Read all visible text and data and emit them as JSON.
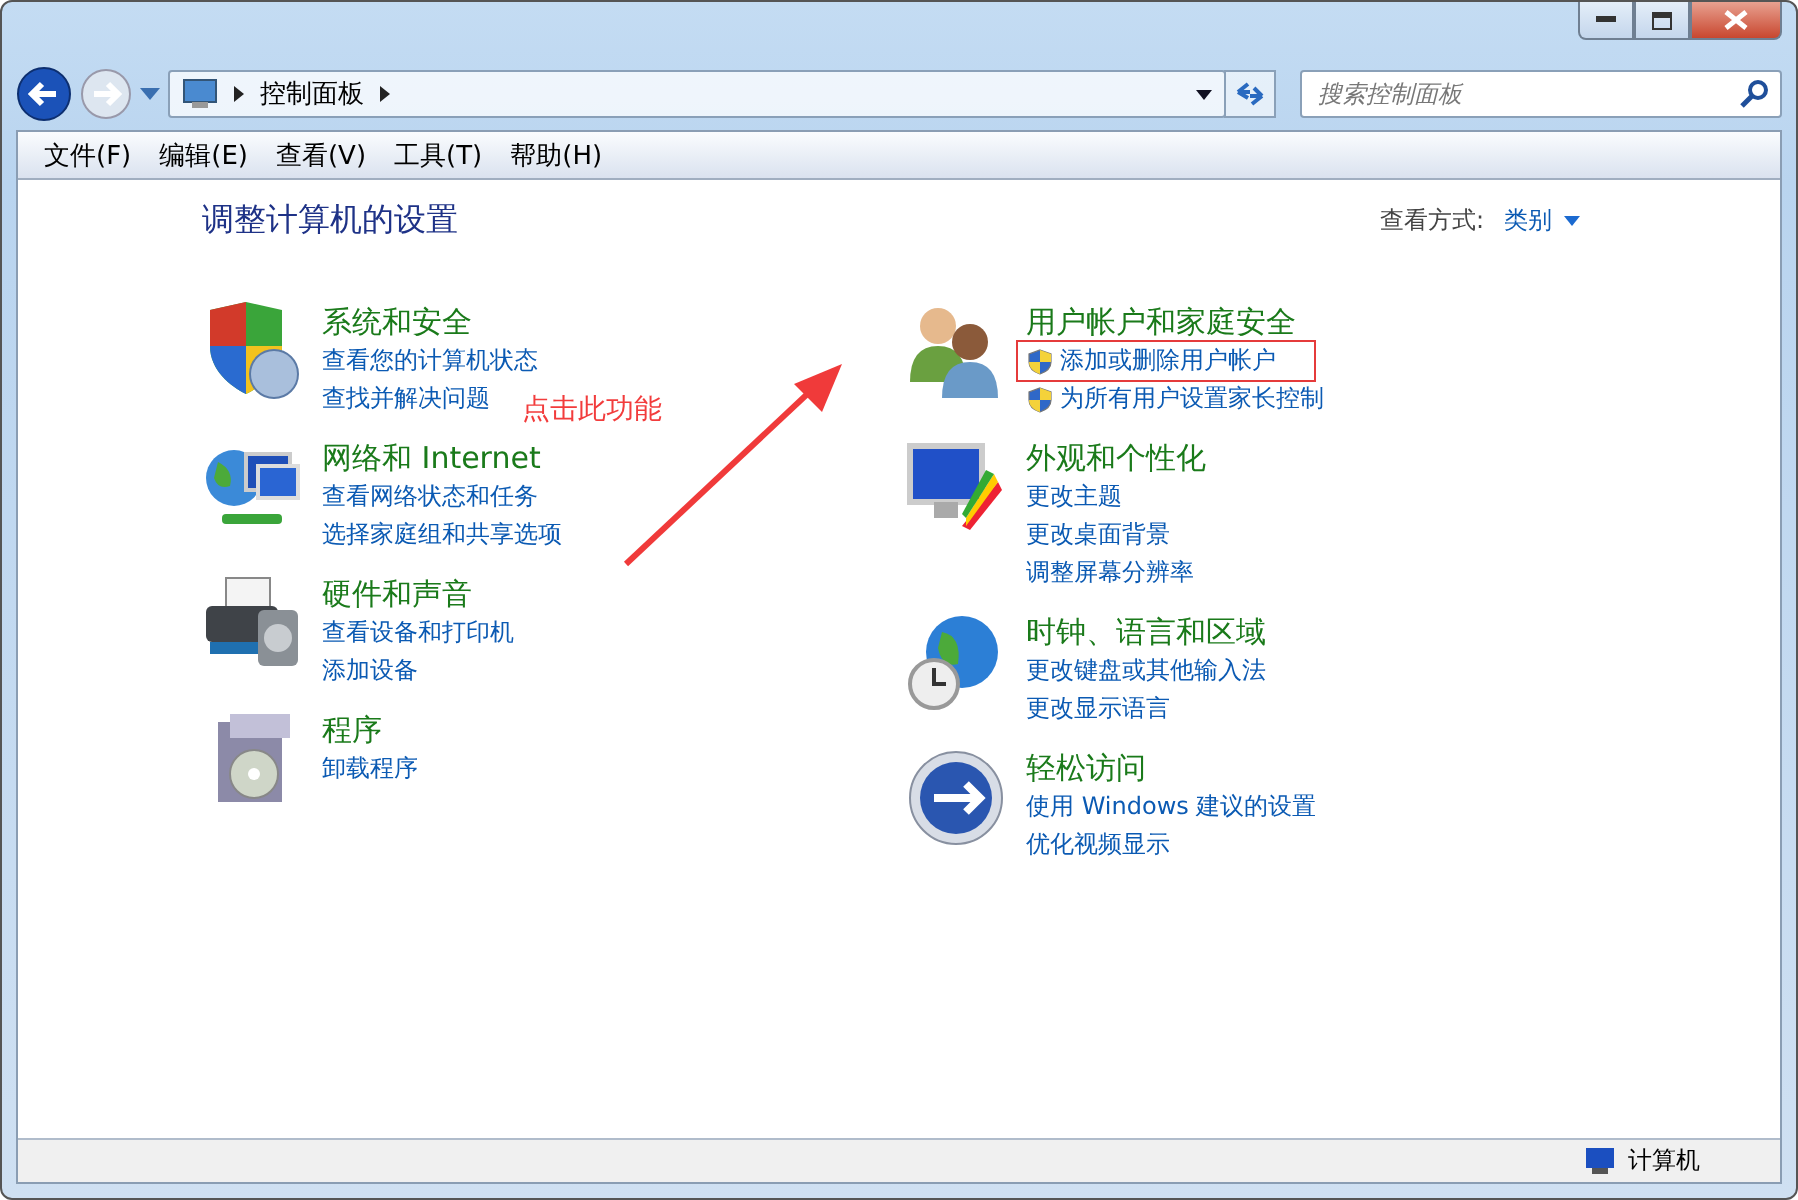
{
  "address": {
    "crumbs": [
      "控制面板"
    ]
  },
  "search": {
    "placeholder": "搜索控制面板"
  },
  "menu": [
    "文件(F)",
    "编辑(E)",
    "查看(V)",
    "工具(T)",
    "帮助(H)"
  ],
  "heading": "调整计算机的设置",
  "view_by": {
    "label": "查看方式:",
    "value": "类别"
  },
  "columns": [
    [
      {
        "title": "系统和安全",
        "links": [
          {
            "text": "查看您的计算机状态"
          },
          {
            "text": "查找并解决问题"
          }
        ]
      },
      {
        "title": "网络和 Internet",
        "links": [
          {
            "text": "查看网络状态和任务"
          },
          {
            "text": "选择家庭组和共享选项"
          }
        ]
      },
      {
        "title": "硬件和声音",
        "links": [
          {
            "text": "查看设备和打印机"
          },
          {
            "text": "添加设备"
          }
        ]
      },
      {
        "title": "程序",
        "links": [
          {
            "text": "卸载程序"
          }
        ]
      }
    ],
    [
      {
        "title": "用户帐户和家庭安全",
        "links": [
          {
            "text": "添加或删除用户帐户",
            "kind": "shield",
            "highlighted": true
          },
          {
            "text": "为所有用户设置家长控制",
            "kind": "shield",
            "highlighted": false
          }
        ]
      },
      {
        "title": "外观和个性化",
        "links": [
          {
            "text": "更改主题"
          },
          {
            "text": "更改桌面背景"
          },
          {
            "text": "调整屏幕分辨率"
          }
        ]
      },
      {
        "title": "时钟、语言和区域",
        "links": [
          {
            "text": "更改键盘或其他输入法"
          },
          {
            "text": "更改显示语言"
          }
        ]
      },
      {
        "title": "轻松访问",
        "links": [
          {
            "text": "使用 Windows 建议的设置"
          },
          {
            "text": "优化视频显示"
          }
        ]
      }
    ]
  ],
  "annotation": {
    "text": "点击此功能"
  },
  "status_bar": {
    "location": "计算机"
  }
}
